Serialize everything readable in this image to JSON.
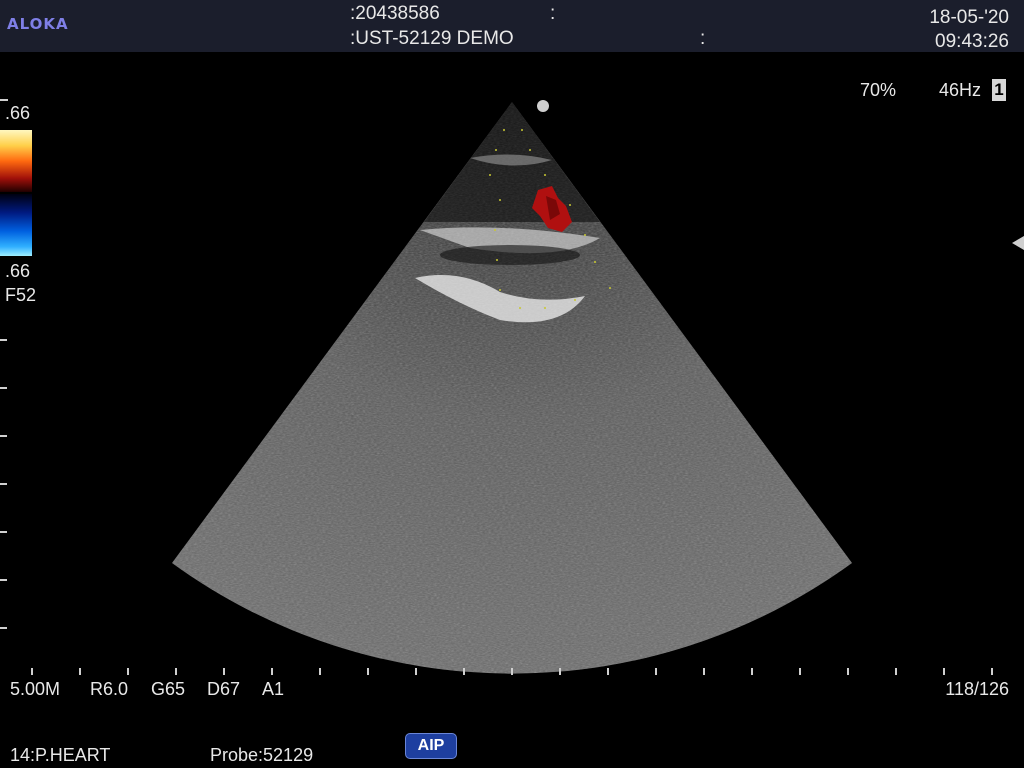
{
  "header": {
    "brand": "ALOKA",
    "patient_id": ":20438586",
    "patient_id_sep": ":",
    "institution": ":UST-52129 DEMO",
    "institution_sep": ":",
    "date": "18-05-'20",
    "time": "09:43:26"
  },
  "imaging": {
    "gain_percent": "70%",
    "frame_rate": "46Hz",
    "frame_number": "1",
    "color_scale_top": ".66",
    "color_scale_bottom": ".66",
    "color_filter": "F52",
    "frequency": "5.00M",
    "range": "R6.0",
    "gain": "G65",
    "depth": "D67",
    "acoustic_power": "A1",
    "frame_counter": "118/126"
  },
  "footer": {
    "preset": "14:P.HEART",
    "probe": "Probe:52129",
    "aip_label": "AIP"
  },
  "colors": {
    "header_bg": "#1b1e2c",
    "brand": "#7f7fe6",
    "doppler_red": "#b01010",
    "aip_button": "#1e3fa0"
  },
  "icons": {
    "orientation_dot": "probe-orientation-dot-icon",
    "focus_marker": "focus-marker-icon"
  }
}
